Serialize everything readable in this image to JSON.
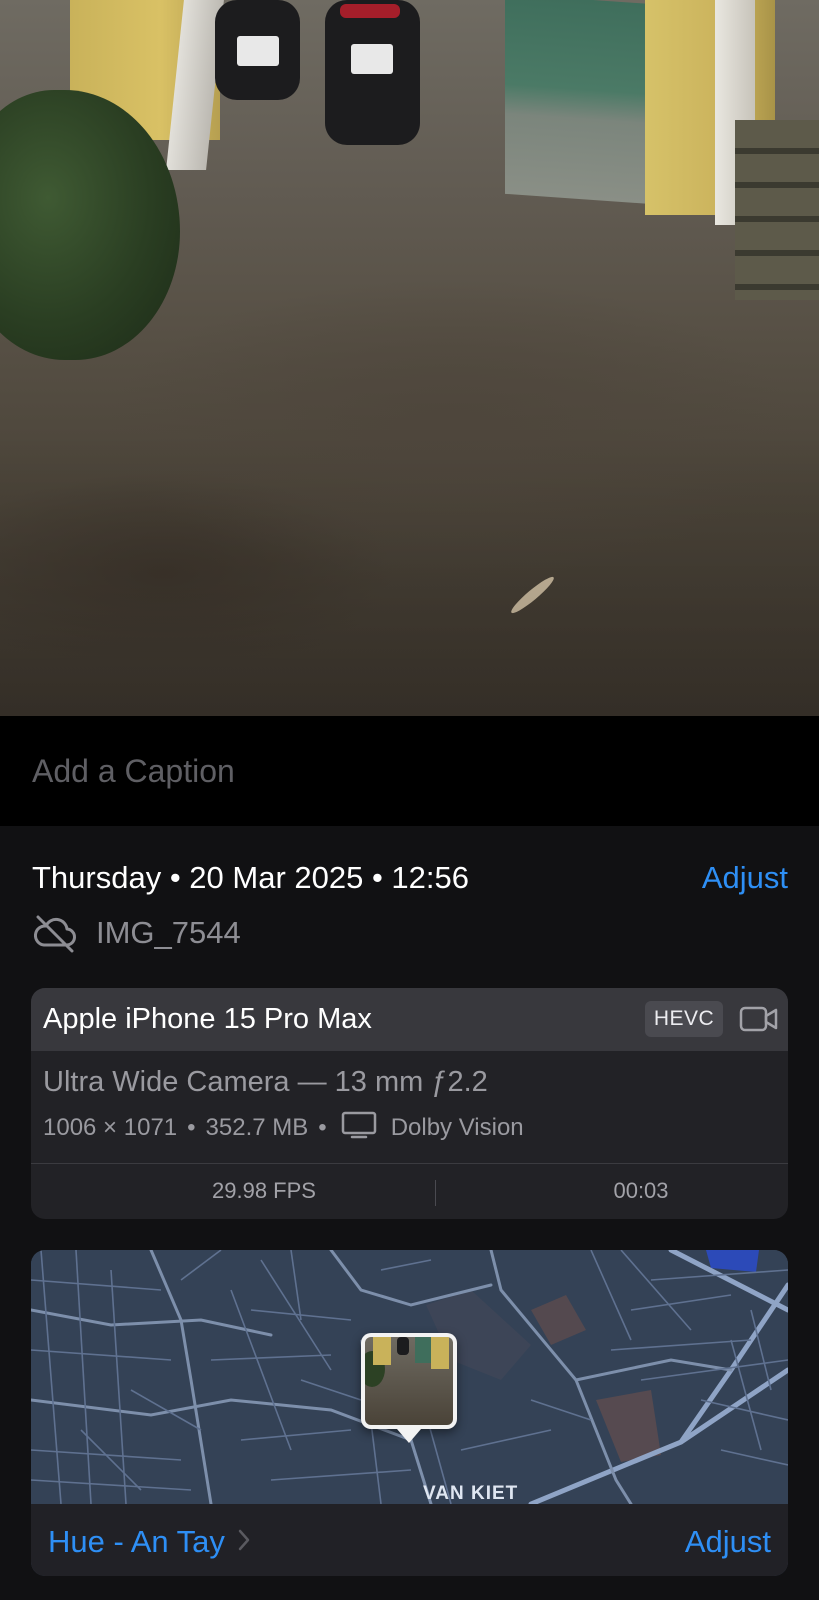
{
  "caption": {
    "placeholder": "Add a Caption"
  },
  "info": {
    "datetime": "Thursday • 20 Mar 2025 • 12:56",
    "adjust_label": "Adjust",
    "filename": "IMG_7544",
    "cloud_icon": "icloud-off-icon"
  },
  "camera": {
    "device": "Apple iPhone 15 Pro Max",
    "codec": "HEVC",
    "video_icon": "video-camera-icon",
    "lens": "Ultra Wide Camera — 13 mm ƒ2.2",
    "resolution": "1006 × 1071",
    "size": "352.7 MB",
    "display_icon": "display-icon",
    "hdr": "Dolby Vision",
    "fps": "29.98 FPS",
    "duration": "00:03"
  },
  "map": {
    "road_label": "VAN KIET",
    "place": "Hue - An Tay",
    "adjust_label": "Adjust"
  },
  "colors": {
    "accent": "#2e8ff5",
    "background": "#111113",
    "card": "#222226",
    "card_header": "#38383d"
  }
}
